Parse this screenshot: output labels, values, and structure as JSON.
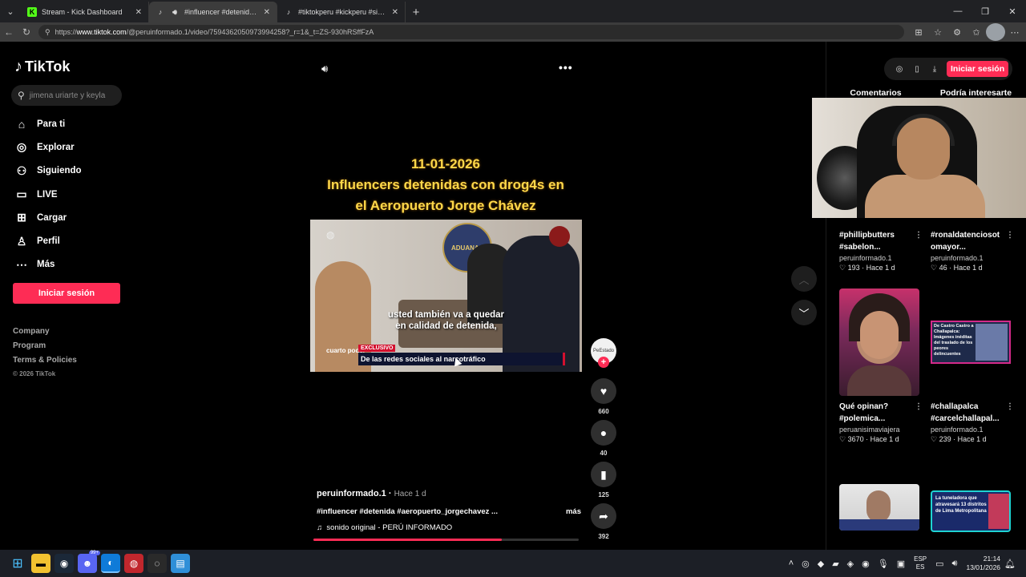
{
  "browser": {
    "tabs": [
      {
        "title": "Stream - Kick Dashboard",
        "icon": "kick-icon",
        "active": false
      },
      {
        "title": "#influencer #detenida #aeropuerto",
        "icon": "tiktok-icon",
        "active": true
      },
      {
        "title": "#tiktokperu #kickperu #sideral #sub",
        "icon": "tiktok-icon",
        "active": false
      }
    ],
    "url_prefix": "https://",
    "url_host": "www.tiktok.com",
    "url_path": "/@peruinformado.1/video/7594362050973994258?_r=1&_t=ZS-930hRSffFzA"
  },
  "sidebar": {
    "logo": "TikTok",
    "search_placeholder": "jimena uriarte y keyla",
    "nav": [
      {
        "label": "Para ti",
        "icon": "home-icon"
      },
      {
        "label": "Explorar",
        "icon": "compass-icon"
      },
      {
        "label": "Siguiendo",
        "icon": "following-icon"
      },
      {
        "label": "LIVE",
        "icon": "live-icon"
      },
      {
        "label": "Cargar",
        "icon": "upload-icon"
      },
      {
        "label": "Perfil",
        "icon": "profile-icon"
      },
      {
        "label": "Más",
        "icon": "more-icon"
      }
    ],
    "login_label": "Iniciar sesión",
    "links": [
      "Company",
      "Program",
      "Terms & Policies"
    ],
    "copyright": "© 2026 TikTok"
  },
  "video": {
    "title_lines": [
      "11-01-2026",
      "Influencers detenidas con drog4s en",
      "el Aeropuerto Jorge Chávez"
    ],
    "seal_text": "ADUANAS",
    "caption_lines": [
      "usted también va a quedar",
      "en calidad de detenida,"
    ],
    "badge": "EXCLUSIVO",
    "banner": "De las redes sociales al narcotráfico",
    "channel": "cuarto poder",
    "author": "peruinformado.1",
    "time": "Hace 1 d",
    "tags": "#influencer #detenida #aeropuerto_jorgechavez ...",
    "more": "más",
    "sound": "sonido original - PERÚ INFORMADO",
    "progress": 0.71
  },
  "actions": {
    "avatar_text": "PeEstado",
    "likes": "660",
    "comments": "40",
    "saves": "125",
    "shares": "392"
  },
  "right_panel": {
    "login_label": "Iniciar sesión",
    "tabs": [
      "Comentarios",
      "Podría interesarte"
    ],
    "cards": [
      {
        "title1": "#phillipbutters",
        "title2": "#sabelon...",
        "user": "peruinformado.1",
        "likes": "193",
        "time": "Hace 1 d"
      },
      {
        "title1": "#ronaldatenciosot",
        "title2": "omayor...",
        "user": "peruinformado.1",
        "likes": "46",
        "time": "Hace 1 d"
      },
      {
        "title1": "Qué opinan?",
        "title2": "#polemica...",
        "user": "peruanisimaviajera",
        "likes": "3670",
        "time": "Hace 1 d"
      },
      {
        "title1": "#challapalca",
        "title2": "#carcelchallapal...",
        "user": "peruinformado.1",
        "likes": "239",
        "time": "Hace 1 d"
      }
    ],
    "thumb_text_2": "De Castro Castro a Challapalca: Imágenes inéditas del traslado de los peores delincuentes",
    "thumb_text_4": "La tuneladora que atravesará 13 distritos de Lima Metropolitana"
  },
  "taskbar": {
    "lang_top": "ESP",
    "lang_bottom": "ES",
    "time": "21:14",
    "date": "13/01/2026",
    "badge": "99+"
  },
  "colors": {
    "accent": "#fe2c55",
    "title_yellow": "#ffd84a",
    "background": "#000000"
  }
}
